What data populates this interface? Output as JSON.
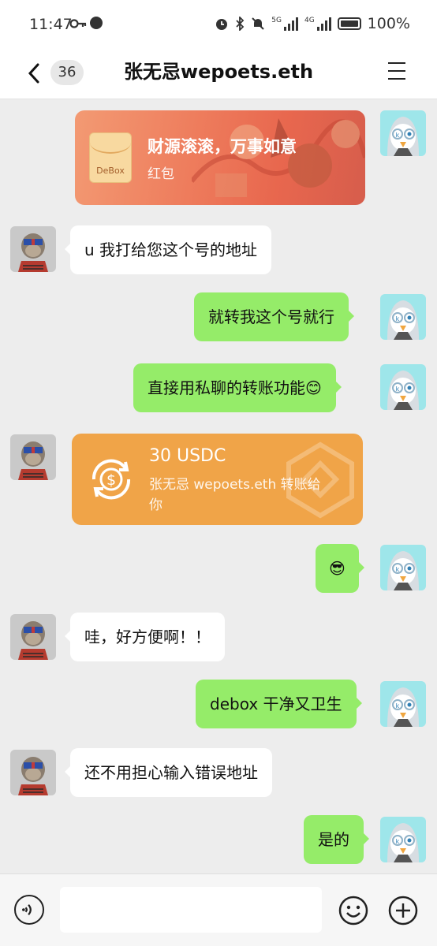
{
  "status_bar": {
    "time": "11:47",
    "battery": "100%",
    "net1": "5G",
    "net2": "4G"
  },
  "header": {
    "unread_count": "36",
    "title": "张无忌wepoets.eth"
  },
  "messages": {
    "red_packet": {
      "title": "财源滚滚，万事如意",
      "subtitle": "红包",
      "envelope_label": "DeBox"
    },
    "m1": {
      "text": "u 我打给您这个号的地址"
    },
    "m2": {
      "text": "就转我这个号就行"
    },
    "m3": {
      "text": "直接用私聊的转账功能😊"
    },
    "transfer": {
      "amount": "30 USDC",
      "description": "张无忌 wepoets.eth 转账给你"
    },
    "m4": {
      "text": "😎"
    },
    "m5": {
      "text": "哇，好方便啊！！"
    },
    "m6": {
      "text": "debox 干净又卫生"
    },
    "m7": {
      "text": "还不用担心输入错误地址"
    },
    "m8": {
      "text": "是的"
    }
  },
  "input_bar": {
    "value": ""
  },
  "colors": {
    "outgoing_bubble": "#95ec69",
    "incoming_bubble": "#ffffff",
    "transfer_card": "#f0a448",
    "red_packet": "#e8674e",
    "chat_background": "#ededed"
  }
}
